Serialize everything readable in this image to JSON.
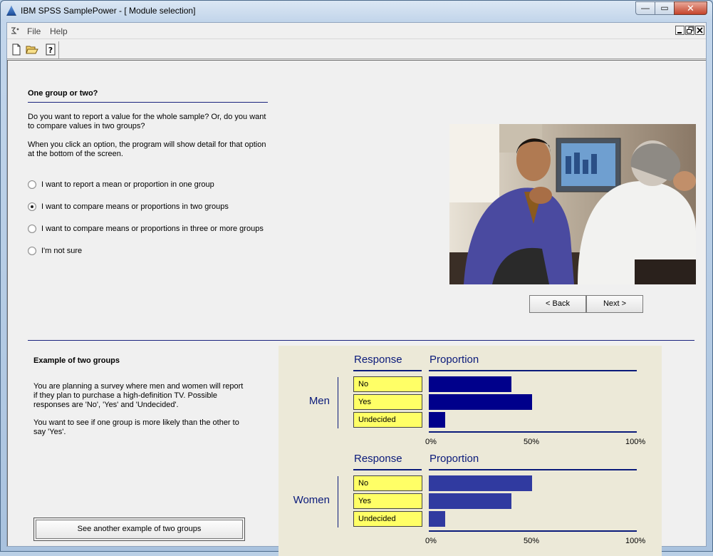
{
  "window": {
    "title": "IBM SPSS SamplePower - [ Module selection]",
    "min_glyph": "—",
    "max_glyph": "▭",
    "close_glyph": "✕"
  },
  "menu": {
    "file": "File",
    "help": "Help"
  },
  "toolbar": {
    "new_icon": "new-document-icon",
    "open_icon": "open-folder-icon",
    "help_icon": "help-icon"
  },
  "question": {
    "title": "One group or two?",
    "para1": "Do you want to report a value for the whole sample?  Or, do you want to compare values in two groups?",
    "para2": "When you click an option, the program will show detail for that option at the bottom of the screen.",
    "options": [
      "I want to report a mean or proportion in one group",
      "I want to compare means or proportions in two groups",
      "I want to compare means or proportions in three or more groups",
      "I'm not sure"
    ],
    "selected": 1
  },
  "nav": {
    "back": "< Back",
    "next": "Next >"
  },
  "example": {
    "title": "Example of two groups",
    "para1": "You are planning a survey where men and women will report if they plan to purchase a high-definition TV. Possible responses are 'No', 'Yes' and 'Undecided'.",
    "para2": "You want to see if one group is more likely than the other to say 'Yes'.",
    "button": "See another example of two groups"
  },
  "chart_data": [
    {
      "type": "bar",
      "group": "Men",
      "response_header": "Response",
      "proportion_header": "Proportion",
      "categories": [
        "No",
        "Yes",
        "Undecided"
      ],
      "values": [
        40,
        50,
        8
      ],
      "ticks": [
        "0%",
        "50%",
        "100%"
      ],
      "xlim": [
        0,
        100
      ],
      "color": "#00008b"
    },
    {
      "type": "bar",
      "group": "Women",
      "response_header": "Response",
      "proportion_header": "Proportion",
      "categories": [
        "No",
        "Yes",
        "Undecided"
      ],
      "values": [
        50,
        40,
        8
      ],
      "ticks": [
        "0%",
        "50%",
        "100%"
      ],
      "xlim": [
        0,
        100
      ],
      "color": "#303aa0"
    }
  ]
}
